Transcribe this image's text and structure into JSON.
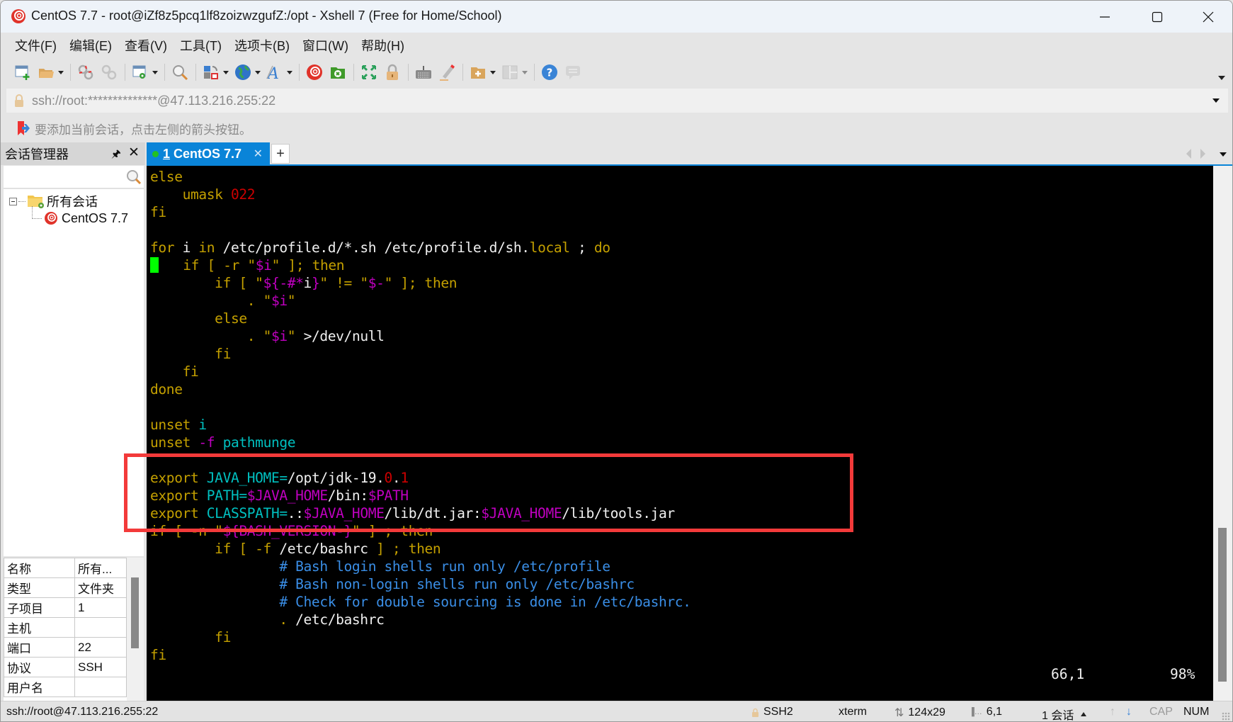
{
  "window": {
    "title": "CentOS 7.7 - root@iZf8z5pcq1lf8zoizwzgufZ:/opt - Xshell 7 (Free for Home/School)"
  },
  "menu": {
    "items": [
      {
        "label": "文件(F)"
      },
      {
        "label": "编辑(E)"
      },
      {
        "label": "查看(V)"
      },
      {
        "label": "工具(T)"
      },
      {
        "label": "选项卡(B)"
      },
      {
        "label": "窗口(W)"
      },
      {
        "label": "帮助(H)"
      }
    ]
  },
  "toolbar": {
    "icons": [
      "new-session-icon",
      "open-folder-icon",
      "disconnect-icon",
      "reconnect-icon",
      "session-properties-icon",
      "find-icon",
      "transfer-icon",
      "globe-icon",
      "font-icon",
      "xshell-icon",
      "xftp-icon",
      "fullscreen-icon",
      "lock-icon",
      "keyboard-icon",
      "highlight-pen-icon",
      "new-folder-icon",
      "layout-icon",
      "help-icon",
      "chat-icon"
    ]
  },
  "address": {
    "value": "ssh://root:**************@47.113.216.255:22"
  },
  "infobar": {
    "text": "要添加当前会话，点击左侧的箭头按钮。"
  },
  "session_manager": {
    "title": "会话管理器",
    "search_placeholder": "",
    "tree": {
      "root": "所有会话",
      "children": [
        "CentOS 7.7"
      ]
    },
    "properties": [
      {
        "key": "名称",
        "value": "所有..."
      },
      {
        "key": "类型",
        "value": "文件夹"
      },
      {
        "key": "子项目",
        "value": "1"
      },
      {
        "key": "主机",
        "value": ""
      },
      {
        "key": "端口",
        "value": "22"
      },
      {
        "key": "协议",
        "value": "SSH"
      },
      {
        "key": "用户名",
        "value": ""
      }
    ]
  },
  "tabs": {
    "active": {
      "number": "1",
      "label": " CentOS 7.7"
    },
    "add_label": "+"
  },
  "terminal": {
    "lines": [
      [
        {
          "t": "else",
          "c": "y"
        }
      ],
      [
        {
          "t": "    umask ",
          "c": "y"
        },
        {
          "t": "022",
          "c": "r"
        }
      ],
      [
        {
          "t": "fi",
          "c": "y"
        }
      ],
      [],
      [
        {
          "t": "for",
          "c": "y"
        },
        {
          "t": " i ",
          "c": "w"
        },
        {
          "t": "in",
          "c": "y"
        },
        {
          "t": " /etc/profile.d/*.sh /etc/profile.d/sh.",
          "c": "w"
        },
        {
          "t": "local",
          "c": "y"
        },
        {
          "t": " ; ",
          "c": "w"
        },
        {
          "t": "do",
          "c": "y"
        }
      ],
      [
        {
          "cursor": true
        },
        {
          "t": "   if [ -r ",
          "c": "y"
        },
        {
          "t": "\"",
          "c": "y"
        },
        {
          "t": "$i",
          "c": "m"
        },
        {
          "t": "\"",
          "c": "y"
        },
        {
          "t": " ]; then",
          "c": "y"
        }
      ],
      [
        {
          "t": "        if [ ",
          "c": "y"
        },
        {
          "t": "\"",
          "c": "y"
        },
        {
          "t": "${-#*",
          "c": "m"
        },
        {
          "t": "i",
          "c": "w"
        },
        {
          "t": "}",
          "c": "m"
        },
        {
          "t": "\"",
          "c": "y"
        },
        {
          "t": " != ",
          "c": "y"
        },
        {
          "t": "\"",
          "c": "y"
        },
        {
          "t": "$-",
          "c": "m"
        },
        {
          "t": "\"",
          "c": "y"
        },
        {
          "t": " ]; then",
          "c": "y"
        }
      ],
      [
        {
          "t": "            . ",
          "c": "y"
        },
        {
          "t": "\"",
          "c": "y"
        },
        {
          "t": "$i",
          "c": "m"
        },
        {
          "t": "\"",
          "c": "y"
        }
      ],
      [
        {
          "t": "        else",
          "c": "y"
        }
      ],
      [
        {
          "t": "            . ",
          "c": "y"
        },
        {
          "t": "\"",
          "c": "y"
        },
        {
          "t": "$i",
          "c": "m"
        },
        {
          "t": "\"",
          "c": "y"
        },
        {
          "t": " >/dev/null",
          "c": "w"
        }
      ],
      [
        {
          "t": "        fi",
          "c": "y"
        }
      ],
      [
        {
          "t": "    fi",
          "c": "y"
        }
      ],
      [
        {
          "t": "done",
          "c": "y"
        }
      ],
      [],
      [
        {
          "t": "unset ",
          "c": "y"
        },
        {
          "t": "i",
          "c": "c"
        }
      ],
      [
        {
          "t": "unset ",
          "c": "y"
        },
        {
          "t": "-f",
          "c": "m"
        },
        {
          "t": " pathmunge",
          "c": "c"
        }
      ],
      [],
      [
        {
          "t": "export ",
          "c": "y"
        },
        {
          "t": "JAVA_HOME=",
          "c": "c"
        },
        {
          "t": "/opt/jdk-19.",
          "c": "w"
        },
        {
          "t": "0",
          "c": "r"
        },
        {
          "t": ".",
          "c": "w"
        },
        {
          "t": "1",
          "c": "r"
        }
      ],
      [
        {
          "t": "export ",
          "c": "y"
        },
        {
          "t": "PATH=",
          "c": "c"
        },
        {
          "t": "$JAVA_HOME",
          "c": "m"
        },
        {
          "t": "/bin:",
          "c": "w"
        },
        {
          "t": "$PATH",
          "c": "m"
        }
      ],
      [
        {
          "t": "export ",
          "c": "y"
        },
        {
          "t": "CLASSPATH=",
          "c": "c"
        },
        {
          "t": ".:",
          "c": "w"
        },
        {
          "t": "$JAVA_HOME",
          "c": "m"
        },
        {
          "t": "/lib/dt.jar:",
          "c": "w"
        },
        {
          "t": "$JAVA_HOME",
          "c": "m"
        },
        {
          "t": "/lib/tools.jar",
          "c": "w"
        }
      ],
      [
        {
          "t": "if [ -n ",
          "c": "y"
        },
        {
          "t": "\"",
          "c": "y"
        },
        {
          "t": "${BASH_VERSION-}",
          "c": "m"
        },
        {
          "t": "\"",
          "c": "y"
        },
        {
          "t": " ] ; then",
          "c": "y"
        }
      ],
      [
        {
          "t": "        if [ -f ",
          "c": "y"
        },
        {
          "t": "/etc/bashrc",
          "c": "w"
        },
        {
          "t": " ] ; then",
          "c": "y"
        }
      ],
      [
        {
          "t": "                # Bash login shells run only /etc/profile",
          "c": "b"
        }
      ],
      [
        {
          "t": "                # Bash non-login shells run only /etc/bashrc",
          "c": "b"
        }
      ],
      [
        {
          "t": "                # Check for double sourcing is done in /etc/bashrc.",
          "c": "b"
        }
      ],
      [
        {
          "t": "                . ",
          "c": "y"
        },
        {
          "t": "/etc/bashrc",
          "c": "w"
        }
      ],
      [
        {
          "t": "        fi",
          "c": "y"
        }
      ],
      [
        {
          "t": "fi",
          "c": "y"
        }
      ]
    ],
    "cursor_position": "66,1",
    "scroll_percent": "98%",
    "scroll_fraction": 0.98
  },
  "statusbar": {
    "connection": "ssh://root@47.113.216.255:22",
    "protocol": "SSH2",
    "terminal_type": "xterm",
    "size": "124x29",
    "cursor": "6,1",
    "sessions": "1 会话",
    "cap": "CAP",
    "num": "NUM"
  }
}
